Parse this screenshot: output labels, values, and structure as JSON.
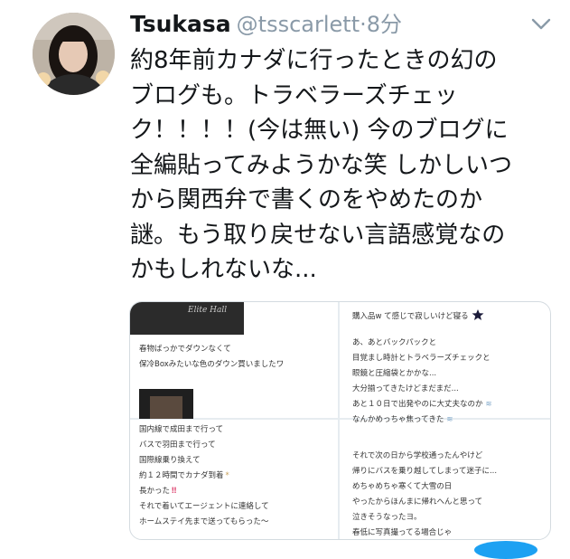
{
  "tweet": {
    "author_name": "Tsukasa",
    "handle": "@tsscarlett",
    "separator": "·",
    "time": "8分",
    "text_lines": [
      "約8年前カナダに行ったときの幻の",
      "ブログも。トラベラーズチェッ",
      "ク！！！！(今は無い) 今のブログに",
      "全編貼ってみようかな笑 しかしいつ",
      "から関西弁で書くのをやめたのか",
      "謎。もう取り戻せない言語感覚なの",
      "かもしれないな..."
    ]
  },
  "media": {
    "images": [
      {
        "logo": "Elite Hall",
        "lines": [
          "春物ばっかでダウンなくて",
          "保冷Boxみたいな色のダウン買いましたワ"
        ]
      },
      {
        "lines": [
          "購入品w て感じで寂しいけど寝る",
          "あ、あとバックパックと",
          "目覚まし時計とトラベラーズチェックと",
          "眼鏡と圧縮袋とかかな...",
          "大分揃ってきたけどまだまだ...",
          "あと１０日で出発やのに大丈夫なのか",
          "なんかめっちゃ焦ってきた"
        ]
      },
      {
        "lines": [
          "国内線で成田まで行って",
          "バスで羽田まで行って",
          "国際線乗り換えて",
          "約１２時間でカナダ到着",
          "長かった",
          "それで着いてエージェントに連絡して",
          "ホームステイ先まで送ってもらった〜"
        ]
      },
      {
        "lines": [
          "それで次の日から学校通ったんやけど",
          "帰りにバスを乗り越してしまって迷子に...",
          "めちゃめちゃ寒くて大雪の日",
          "やったからほんまに帰れへんと思って",
          "泣きそうなったヨ。",
          "春低に写真撮ってる場合じゃ"
        ]
      }
    ]
  },
  "colors": {
    "text": "#14171a",
    "muted": "#8a9aa8",
    "accent": "#1da1f2",
    "border": "#d4dbe0"
  },
  "icons": [
    "avatar",
    "chevron-down-icon",
    "star-icon",
    "sparkle-icon",
    "moon-icon"
  ]
}
